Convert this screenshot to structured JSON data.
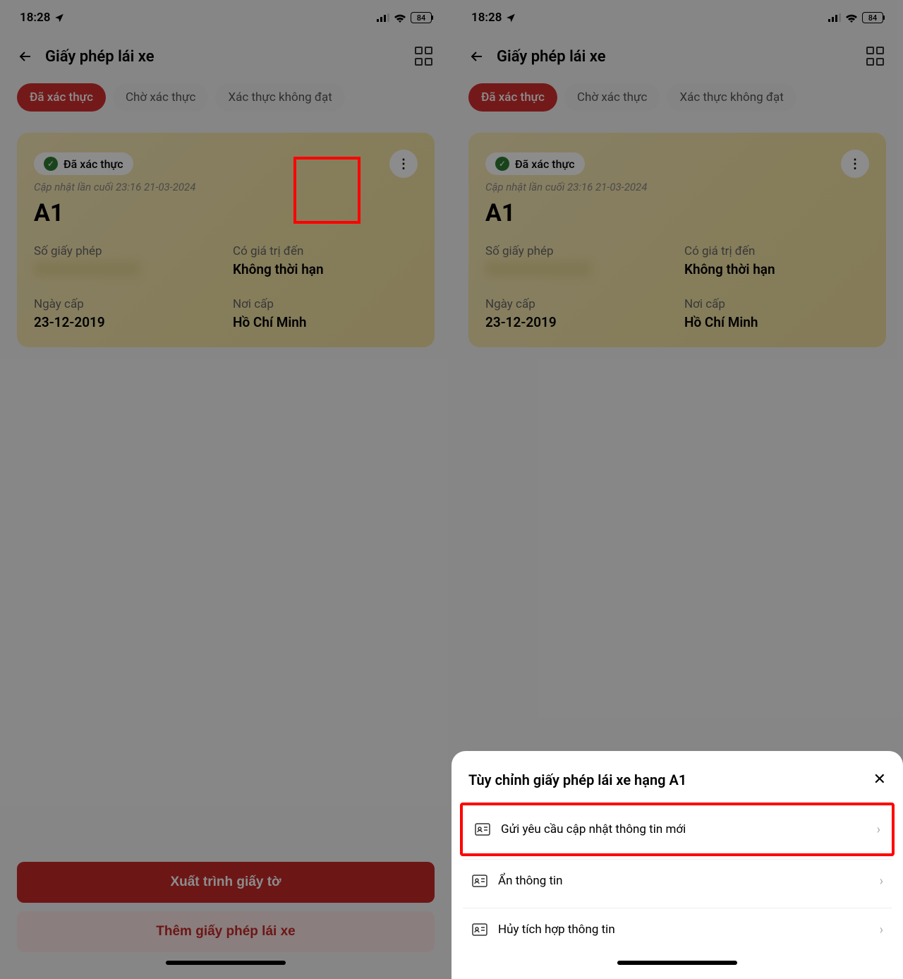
{
  "statusBar": {
    "time": "18:28",
    "battery": "84"
  },
  "header": {
    "title": "Giấy phép lái xe"
  },
  "tabs": [
    {
      "label": "Đã xác thực",
      "active": true
    },
    {
      "label": "Chờ xác thực",
      "active": false
    },
    {
      "label": "Xác thực không đạt",
      "active": false
    }
  ],
  "card": {
    "badge": "Đã xác thực",
    "updated": "Cập nhật lần cuối 23:16 21-03-2024",
    "class": "A1",
    "fields": {
      "licenseNumber": {
        "label": "Số giấy phép"
      },
      "validUntil": {
        "label": "Có giá trị đến",
        "value": "Không thời hạn"
      },
      "issueDate": {
        "label": "Ngày cấp",
        "value": "23-12-2019"
      },
      "issuePlace": {
        "label": "Nơi cấp",
        "value": "Hồ Chí Minh"
      }
    }
  },
  "buttons": {
    "present": "Xuất trình giấy tờ",
    "add": "Thêm giấy phép lái xe"
  },
  "sheet": {
    "title": "Tùy chỉnh giấy phép lái xe hạng A1",
    "items": [
      {
        "label": "Gửi yêu cầu cập nhật thông tin mới",
        "highlighted": true
      },
      {
        "label": "Ẩn thông tin",
        "highlighted": false
      },
      {
        "label": "Hủy tích hợp thông tin",
        "highlighted": false
      }
    ]
  }
}
